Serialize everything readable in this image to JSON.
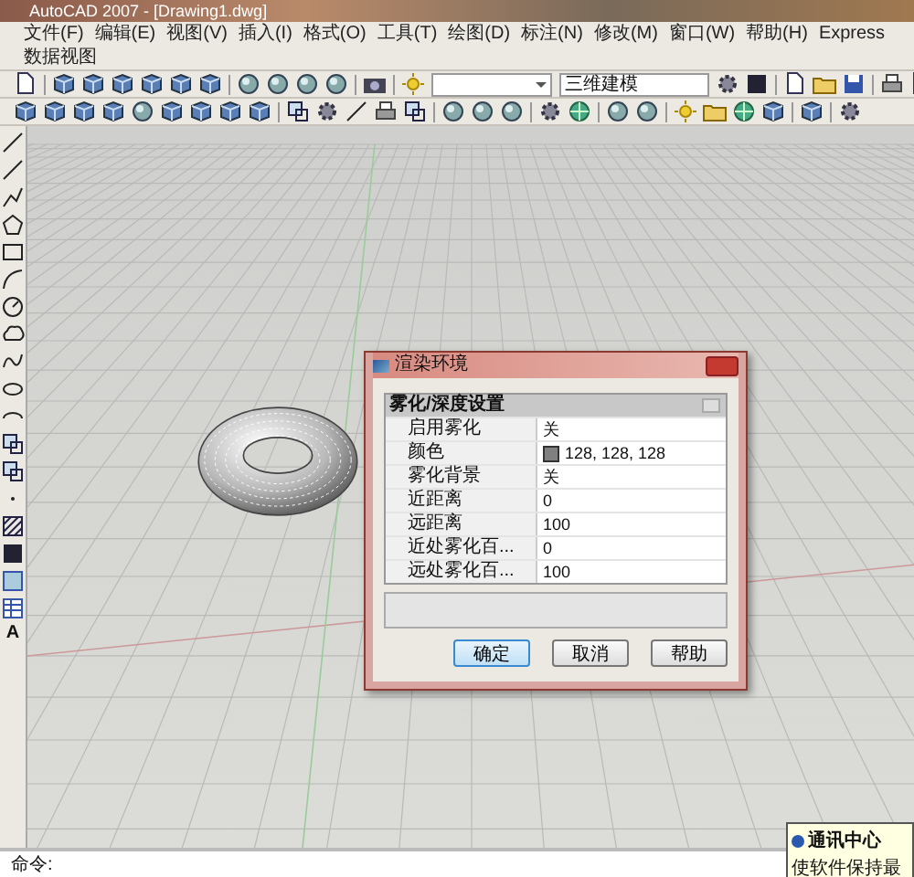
{
  "window": {
    "title": "AutoCAD 2007 - [Drawing1.dwg]"
  },
  "menu": [
    "文件(F)",
    "编辑(E)",
    "视图(V)",
    "插入(I)",
    "格式(O)",
    "工具(T)",
    "绘图(D)",
    "标注(N)",
    "修改(M)",
    "窗口(W)",
    "帮助(H)",
    "Express",
    "数据视图"
  ],
  "toolbar": {
    "workspace": "三维建模"
  },
  "draw_toolbar": {
    "text_tool": "A"
  },
  "dialog": {
    "title": "渲染环境",
    "section": "雾化/深度设置",
    "properties": [
      {
        "label": "启用雾化",
        "value": "关",
        "kind": "text"
      },
      {
        "label": "颜色",
        "value": "128, 128, 128",
        "kind": "color",
        "color": "#808080"
      },
      {
        "label": "雾化背景",
        "value": "关",
        "kind": "text"
      },
      {
        "label": "近距离",
        "value": "0",
        "kind": "text"
      },
      {
        "label": "远距离",
        "value": "100",
        "kind": "text"
      },
      {
        "label": "近处雾化百...",
        "value": "0",
        "kind": "text"
      },
      {
        "label": "远处雾化百...",
        "value": "100",
        "kind": "text"
      }
    ],
    "buttons": [
      {
        "label": "确定",
        "default": true
      },
      {
        "label": "取消",
        "default": false
      },
      {
        "label": "帮助",
        "default": false
      }
    ]
  },
  "command_line": {
    "prompt": "命令:"
  },
  "notification": {
    "title": "通讯中心",
    "message": "使软件保持最"
  }
}
